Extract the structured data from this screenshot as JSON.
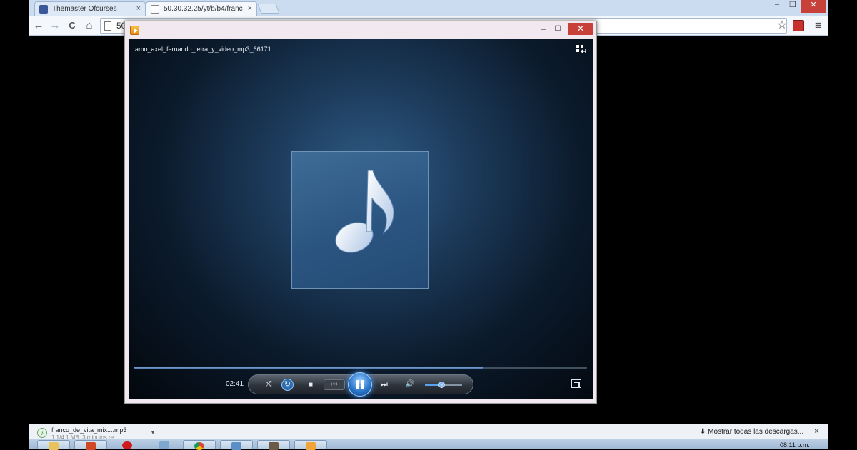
{
  "browser": {
    "tabs": [
      {
        "label": "Themaster Ofcurses",
        "close": "×",
        "favicon": "facebook-icon"
      },
      {
        "label": "50.30.32.25/yt/b/b4/franc",
        "close": "×",
        "favicon": "page-icon"
      }
    ],
    "window_controls": {
      "minimize": "–",
      "restore": "❐",
      "close": "✕"
    },
    "toolbar": {
      "back": "←",
      "forward": "→",
      "reload": "C",
      "home": "⌂",
      "address": "50",
      "star": "☆",
      "menu": "≡"
    }
  },
  "player": {
    "window_controls": {
      "minimize": "–",
      "maximize": "☐",
      "close": "✕"
    },
    "media_title": "amo_axel_fernando_letra_y_video_mp3_66171",
    "time": "02:41",
    "progress": 0.77,
    "volume": 0.45,
    "state": "playing",
    "controls": {
      "shuffle": "⤭",
      "repeat": "↻",
      "stop": "■",
      "previous": "⏮",
      "next": "⏭",
      "mute": "🔊"
    },
    "colors": {
      "accent": "#2b78cc",
      "background": "#0b1a2b"
    }
  },
  "downloads": {
    "item_name": "franco_de_vita_mix....mp3",
    "item_status": "1,1/4,1 MB, 3 minutos re...",
    "show_all": "Mostrar todas las descargas...",
    "close": "×"
  },
  "taskbar": {
    "clock": "08:11 p.m.",
    "apps": [
      "explorer",
      "powerpoint",
      "opera",
      "media-center",
      "chrome",
      "control-panel",
      "gimp",
      "media-player"
    ]
  }
}
